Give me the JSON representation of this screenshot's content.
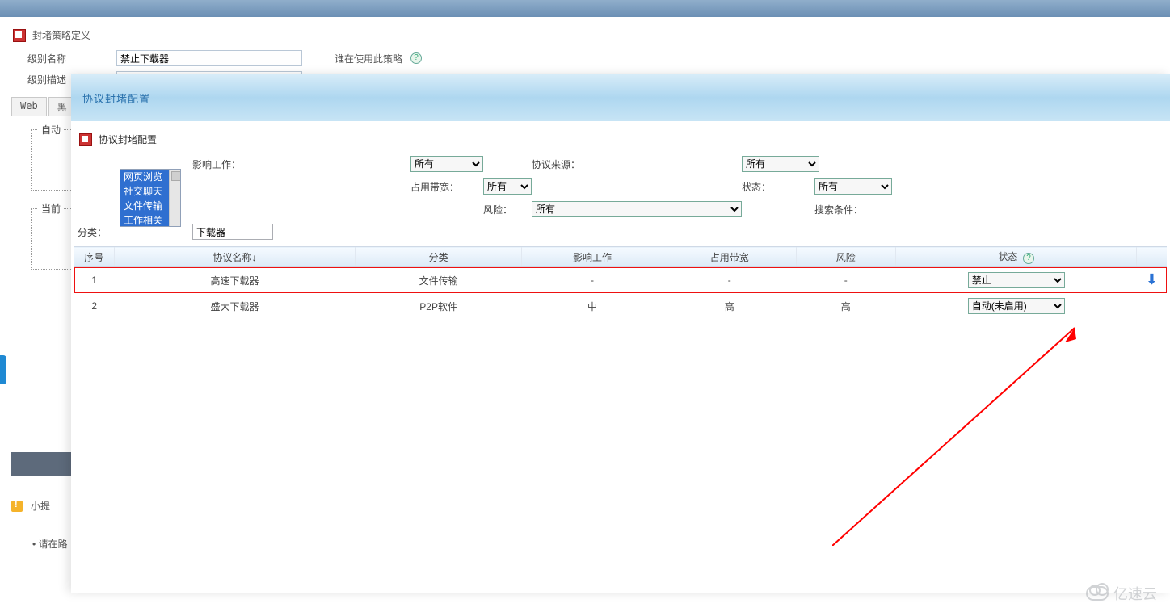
{
  "background": {
    "page_title": "封堵策略定义",
    "fields": {
      "level_name_label": "级别名称",
      "level_name_value": "禁止下载器",
      "level_desc_label": "级别描述",
      "who_uses_label": "谁在使用此策略"
    },
    "tabs": {
      "web": "Web",
      "black": "黑"
    },
    "fieldset_auto": "自动",
    "fieldset_current": "当前",
    "tips_label": "小提",
    "bullet_text": "请在路"
  },
  "modal": {
    "title": "协议封堵配置",
    "config_header": "协议封堵配置",
    "filters": {
      "category_label": "分类：",
      "category_options": [
        "网页浏览",
        "社交聊天",
        "文件传输",
        "工作相关"
      ],
      "impact_label": "影响工作：",
      "impact_value": "所有",
      "bandwidth_label": "占用带宽：",
      "bandwidth_value": "所有",
      "risk_label": "风险：",
      "risk_value": "所有",
      "source_label": "协议来源：",
      "source_value": "所有",
      "state_label": "状态：",
      "state_value": "所有",
      "search_label": "搜索条件：",
      "search_value": "下载器"
    },
    "columns": {
      "seq": "序号",
      "name": "协议名称↓",
      "category": "分类",
      "impact": "影响工作",
      "bandwidth": "占用带宽",
      "risk": "风险",
      "status": "状态"
    },
    "rows": [
      {
        "seq": "1",
        "name": "高速下载器",
        "category": "文件传输",
        "impact": "-",
        "bandwidth": "-",
        "risk": "-",
        "status": "禁止",
        "highlight": true
      },
      {
        "seq": "2",
        "name": "盛大下载器",
        "category": "P2P软件",
        "impact": "中",
        "bandwidth": "高",
        "risk": "高",
        "status": "自动(未启用)",
        "highlight": false
      }
    ],
    "status_options": [
      "禁止",
      "自动(未启用)"
    ]
  },
  "watermark_text": "亿速云"
}
